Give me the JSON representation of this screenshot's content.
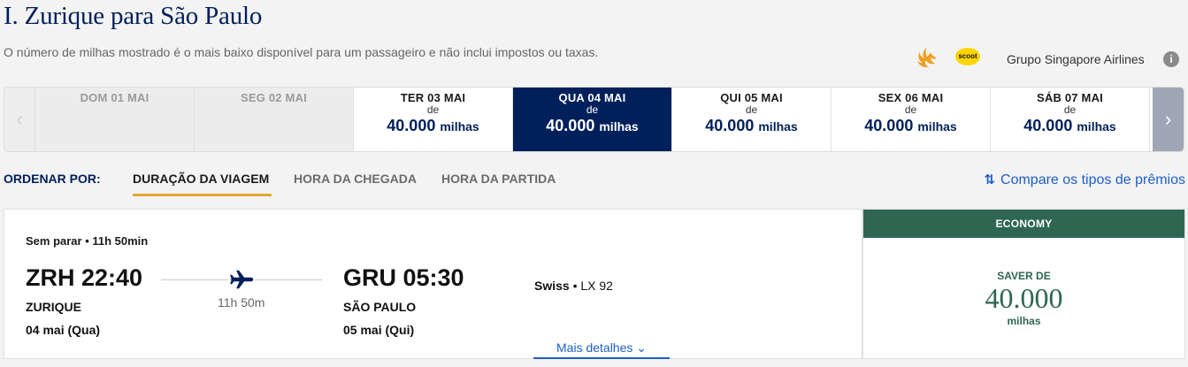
{
  "header": {
    "title": "I. Zurique para São Paulo",
    "subtitle": "O número de milhas mostrado é o mais baixo disponível para um passageiro e não inclui impostos ou taxas.",
    "scoot_logo_text": "scoot",
    "group_label": "Grupo Singapore Airlines",
    "info_icon": "i"
  },
  "date_strip": {
    "prev_icon": "‹",
    "next_icon": "›",
    "days": [
      {
        "label": "DOM 01 MAI",
        "from": "",
        "miles": "",
        "unit": "",
        "state": "disabled"
      },
      {
        "label": "SEG 02 MAI",
        "from": "",
        "miles": "",
        "unit": "",
        "state": "disabled"
      },
      {
        "label": "TER 03 MAI",
        "from": "de",
        "miles": "40.000",
        "unit": "milhas",
        "state": "normal"
      },
      {
        "label": "QUA 04 MAI",
        "from": "de",
        "miles": "40.000",
        "unit": "milhas",
        "state": "selected"
      },
      {
        "label": "QUI 05 MAI",
        "from": "de",
        "miles": "40.000",
        "unit": "milhas",
        "state": "normal"
      },
      {
        "label": "SEX 06 MAI",
        "from": "de",
        "miles": "40.000",
        "unit": "milhas",
        "state": "normal"
      },
      {
        "label": "SÁB 07 MAI",
        "from": "de",
        "miles": "40.000",
        "unit": "milhas",
        "state": "normal"
      }
    ]
  },
  "sort": {
    "label": "ORDENAR POR:",
    "options": [
      "DURAÇÃO DA VIAGEM",
      "HORA DA CHEGADA",
      "HORA DA PARTIDA"
    ],
    "active": "DURAÇÃO DA VIAGEM",
    "compare_icon": "⇅",
    "compare_label": "Compare os tipos de prêmios"
  },
  "flight": {
    "stops": "Sem parar • 11h 50min",
    "departure": {
      "time": "ZRH 22:40",
      "city": "ZURIQUE",
      "date": "04 mai (Qua)"
    },
    "arrival": {
      "time": "GRU 05:30",
      "city": "SÃO PAULO",
      "date": "05 mai (Qui)"
    },
    "duration": "11h 50m",
    "airline": "Swiss",
    "flight_number": "• LX 92",
    "details_label": "Mais detalhes ⌄"
  },
  "fare": {
    "cabin": "ECONOMY",
    "label": "SAVER DE",
    "value": "40.000",
    "unit": "milhas"
  },
  "colors": {
    "brand_navy": "#00205b",
    "economy_green": "#2e6652",
    "link_blue": "#1d5ec7",
    "sort_underline": "#e4a930"
  }
}
